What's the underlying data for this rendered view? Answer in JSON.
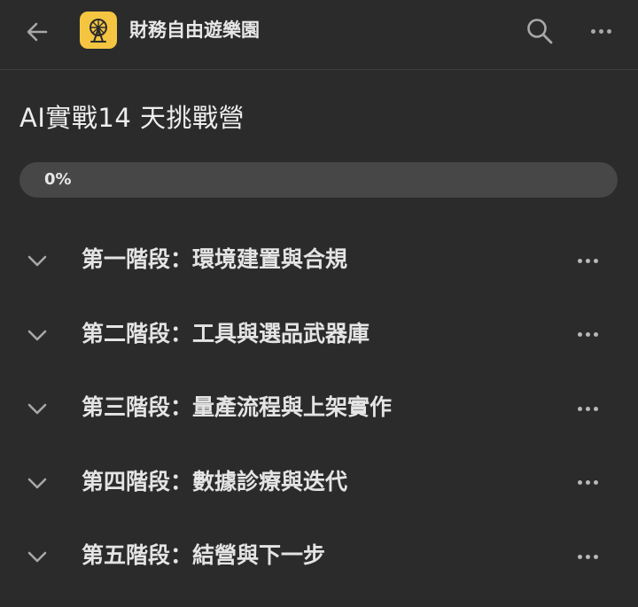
{
  "header": {
    "app_title": "財務自由遊樂園",
    "back_icon": "arrow-left-icon",
    "logo_icon": "ferris-wheel-icon",
    "logo_color": "#f5c542",
    "search_icon": "search-icon",
    "more_icon": "more-horizontal-icon"
  },
  "course": {
    "title": "AI實戰14 天挑戰營",
    "progress_percent": 0,
    "progress_label": "0%"
  },
  "sections": [
    {
      "label": "第一階段：環境建置與合規"
    },
    {
      "label": "第二階段：工具與選品武器庫"
    },
    {
      "label": "第三階段：量產流程與上架實作"
    },
    {
      "label": "第四階段：數據診療與迭代"
    },
    {
      "label": "第五階段：結營與下一步"
    }
  ]
}
